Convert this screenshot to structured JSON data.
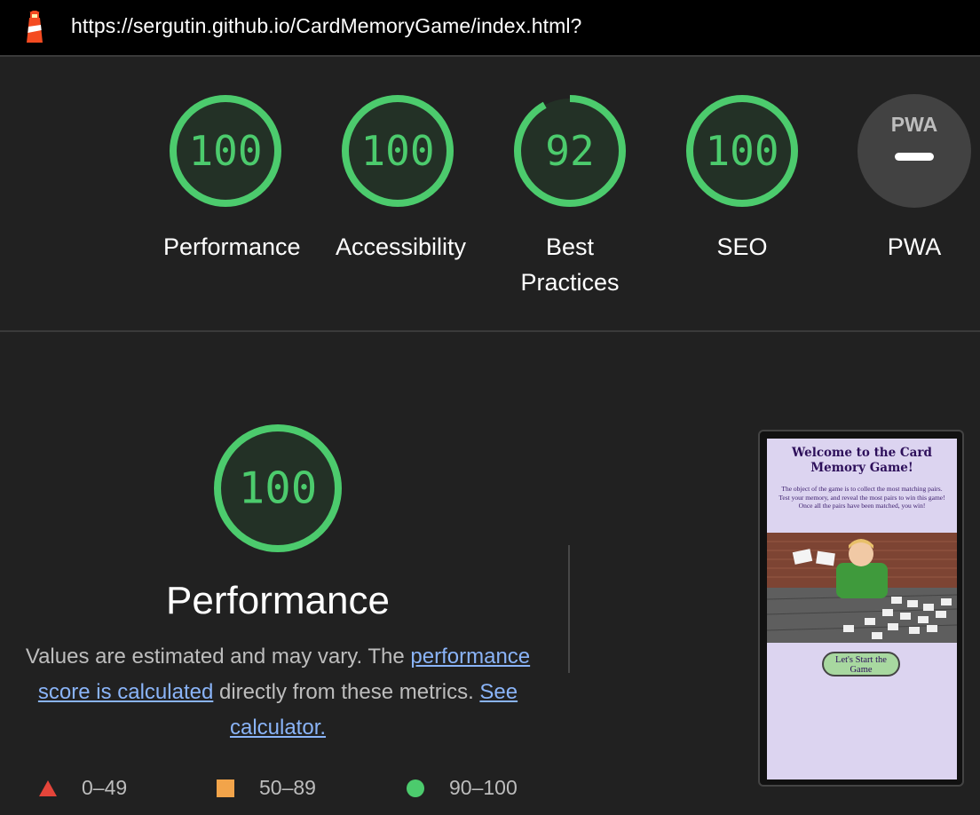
{
  "topbar": {
    "url": "https://sergutin.github.io/CardMemoryGame/index.html?",
    "logo_icon": "lighthouse-icon"
  },
  "gauges": [
    {
      "score": "100",
      "label": "Performance",
      "fraction": 1.0
    },
    {
      "score": "100",
      "label": "Accessibility",
      "fraction": 1.0
    },
    {
      "score": "92",
      "label": "Best Practices",
      "label_line1": "Best",
      "label_line2": "Practices",
      "fraction": 0.92
    },
    {
      "score": "100",
      "label": "SEO",
      "fraction": 1.0
    },
    {
      "badge": "PWA",
      "label": "PWA"
    }
  ],
  "performance": {
    "score": "100",
    "title": "Performance",
    "desc_part1": "Values are estimated and may vary. The ",
    "desc_link1": "performance score is calculated",
    "desc_part2": " directly from these metrics. ",
    "desc_link2": "See calculator."
  },
  "legend": [
    {
      "range": "0–49",
      "icon": "fail-triangle-icon",
      "color": "#e5453a"
    },
    {
      "range": "50–89",
      "icon": "average-square-icon",
      "color": "#f2a44a"
    },
    {
      "range": "90–100",
      "icon": "pass-circle-icon",
      "color": "#4ccb6d"
    }
  ],
  "screenshot": {
    "title": "Welcome to the Card Memory Game!",
    "line1": "The object of the game is to collect the most matching pairs.",
    "line2": "Test your memory, and reveal the most pairs to win this game!",
    "line3": "Once all the pairs have been matched, you win!",
    "button": "Let's Start the Game"
  },
  "colors": {
    "pass": "#4ccb6d",
    "background": "#212121",
    "link": "#8ab4f8"
  }
}
